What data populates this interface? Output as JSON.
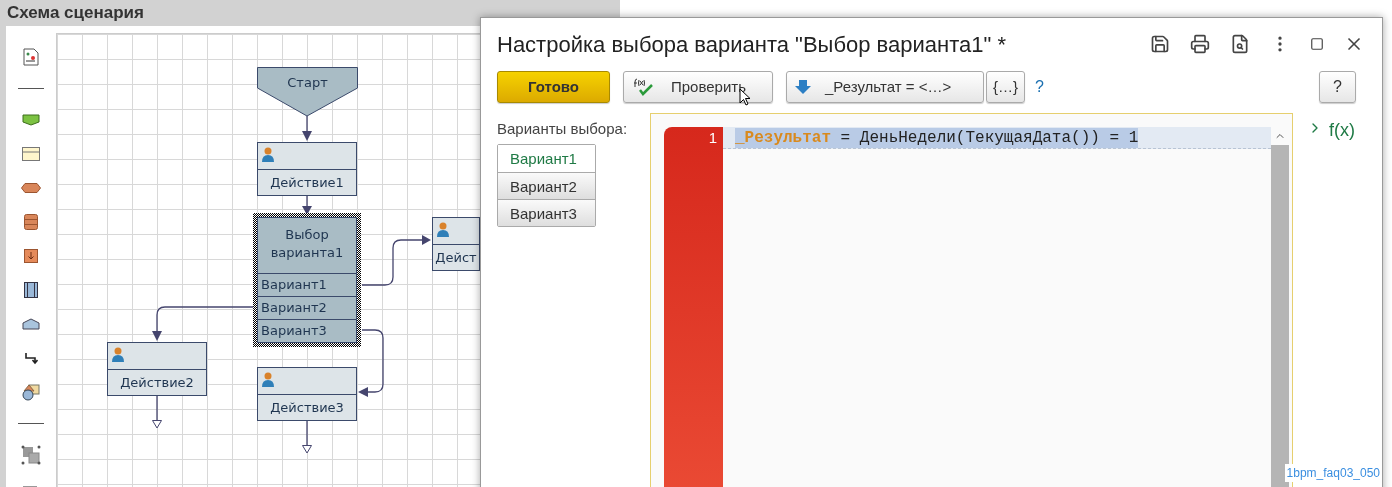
{
  "panel": {
    "title": "Схема сценария"
  },
  "diagram": {
    "nodes": [
      {
        "kind": "start",
        "label": "Старт",
        "selected": false
      },
      {
        "kind": "action",
        "label": "Действие1",
        "selected": false
      },
      {
        "kind": "choice",
        "label": "Выбор варианта1",
        "options": [
          "Вариант1",
          "Вариант2",
          "Вариант3"
        ],
        "selected": true
      },
      {
        "kind": "action",
        "label": "Дейст",
        "selected": false
      },
      {
        "kind": "action",
        "label": "Действие2",
        "selected": false
      },
      {
        "kind": "action",
        "label": "Действие3",
        "selected": false
      }
    ]
  },
  "dialog": {
    "title": "Настройка выбора варианта \"Выбор варианта1\" *",
    "buttons": [
      {
        "kind": "primary",
        "label": "Готово"
      },
      {
        "kind": "check",
        "label": "Проверить"
      },
      {
        "kind": "insert",
        "label": "_Результат = <…>"
      },
      {
        "kind": "braces",
        "label": "{…}"
      }
    ],
    "help_link": "?",
    "help_button": "?",
    "options_label": "Варианты выбора:",
    "options": [
      {
        "label": "Вариант1",
        "selected": true
      },
      {
        "label": "Вариант2",
        "selected": false
      },
      {
        "label": "Вариант3",
        "selected": false
      }
    ],
    "editor": {
      "lines": [
        {
          "number": "1",
          "keyword": "_Результат",
          "text": " = ДеньНедели(ТекущаяДата()) = 1"
        }
      ]
    },
    "fx_toggle": "f(x)"
  },
  "figure_id": "1bpm_faq03_050"
}
